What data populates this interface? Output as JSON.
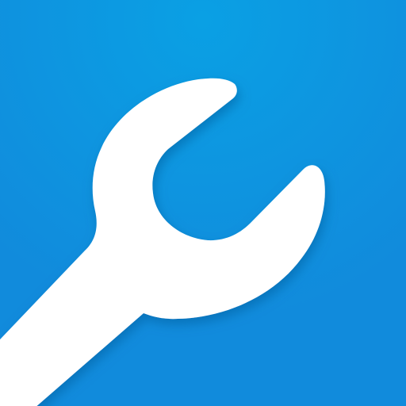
{
  "icon": {
    "name": "wrench-icon",
    "colors": {
      "background": "#118bdc",
      "background_highlight": "#0aa0e4",
      "glyph": "#ffffff",
      "shadow": "#0a5f9e"
    }
  }
}
